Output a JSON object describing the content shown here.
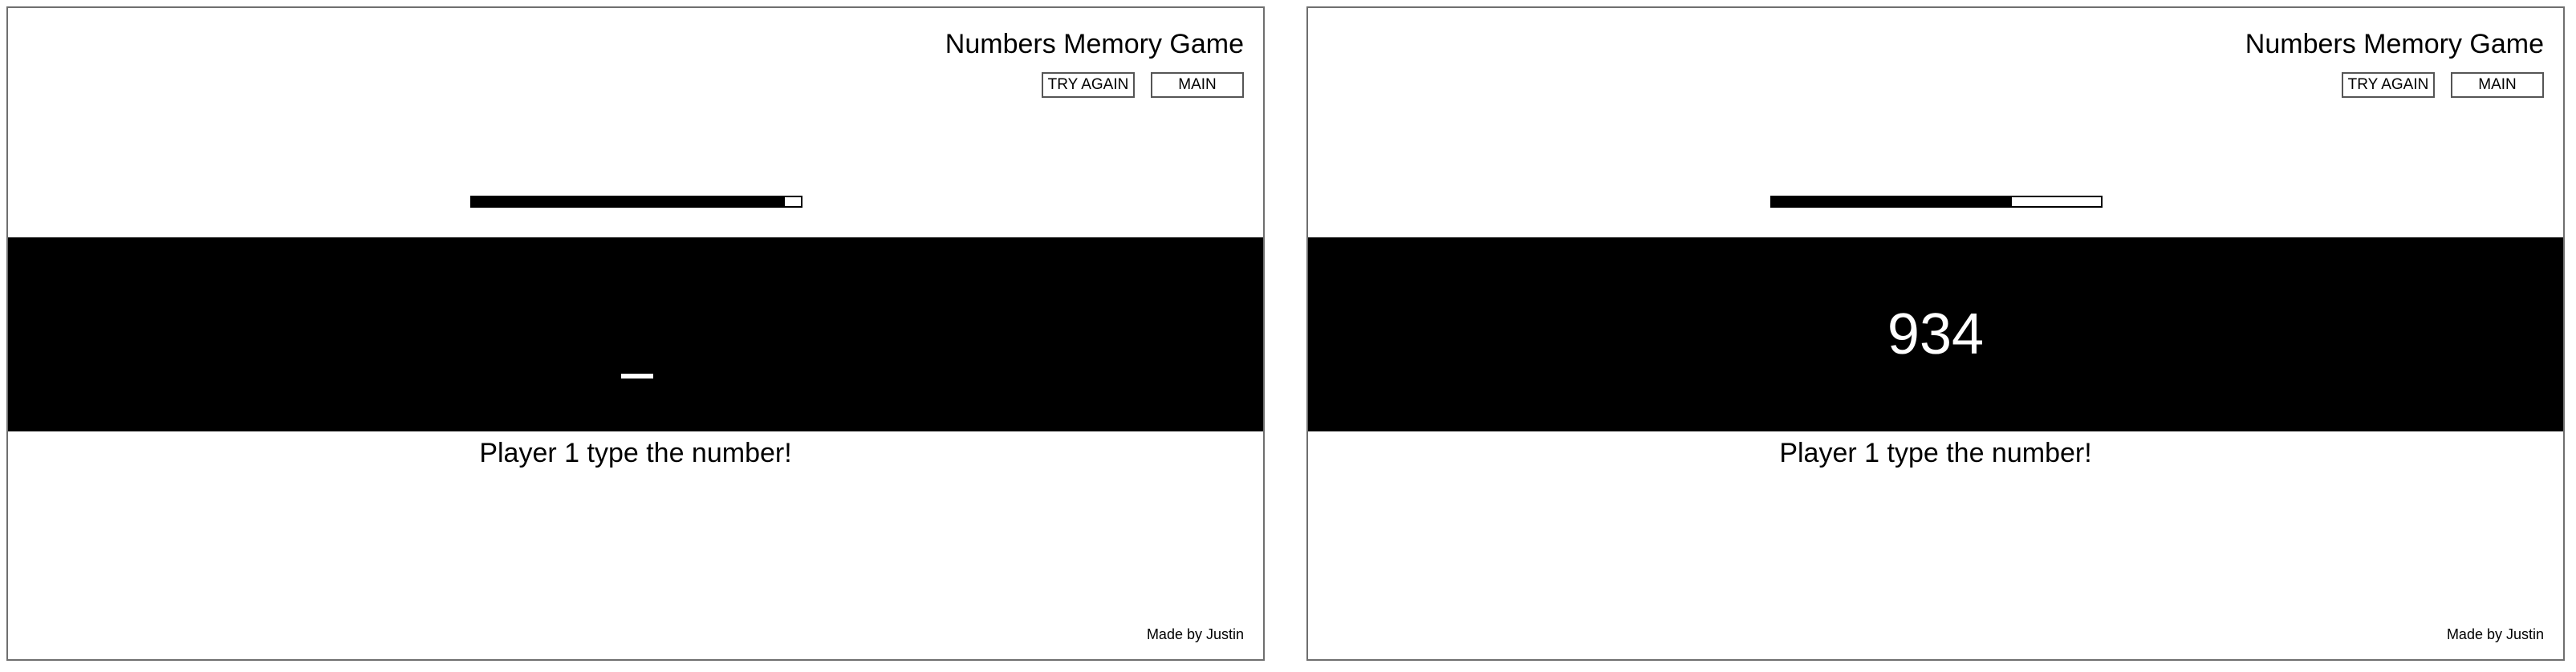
{
  "screens": [
    {
      "title": "Numbers Memory Game",
      "try_again_label": "TRY AGAIN",
      "main_label": "MAIN",
      "timer_remaining_fraction": 0.95,
      "display_text": "",
      "prompt": "Player 1 type the number!",
      "footer": "Made by Justin"
    },
    {
      "title": "Numbers Memory Game",
      "try_again_label": "TRY AGAIN",
      "main_label": "MAIN",
      "timer_remaining_fraction": 0.73,
      "display_text": "934",
      "prompt": "Player 1 type the number!",
      "footer": "Made by Justin"
    }
  ],
  "colors": {
    "background": "#ffffff",
    "band": "#000000",
    "foreground": "#000000",
    "band_text": "#ffffff"
  }
}
